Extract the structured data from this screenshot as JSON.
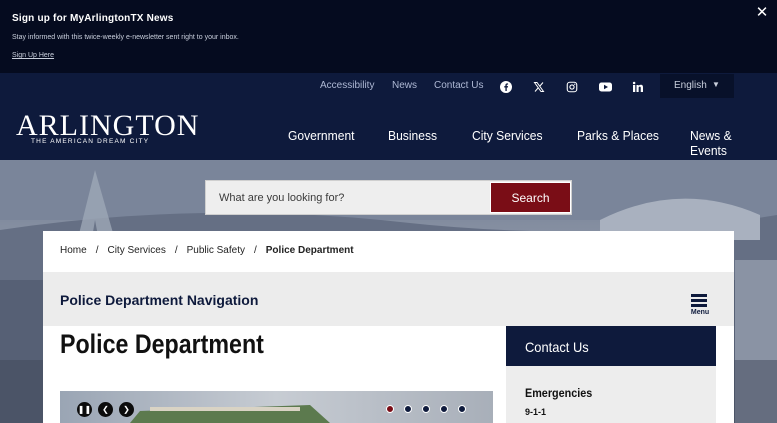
{
  "banner": {
    "title": "Sign up for MyArlingtonTX News",
    "text": "Stay informed with this twice-weekly e-newsletter sent right to your inbox.",
    "link": "Sign Up Here",
    "close": "✕"
  },
  "utility": {
    "links": [
      "Accessibility",
      "News",
      "Contact Us"
    ],
    "social_icons": [
      "facebook-icon",
      "x-twitter-icon",
      "instagram-icon",
      "youtube-icon",
      "linkedin-icon"
    ],
    "language": "English"
  },
  "logo": {
    "name": "ARLINGTON",
    "tagline": "THE AMERICAN DREAM CITY"
  },
  "nav": {
    "items": [
      "Government",
      "Business",
      "City Services",
      "Parks & Places",
      "News & Events"
    ]
  },
  "search": {
    "placeholder": "What are you looking for?",
    "button": "Search"
  },
  "breadcrumb": {
    "items": [
      "Home",
      "City Services",
      "Public Safety"
    ],
    "current": "Police Department",
    "separator": "/"
  },
  "subnav": {
    "title": "Police Department Navigation",
    "menu_label": "Menu"
  },
  "page": {
    "title": "Police Department"
  },
  "carousel": {
    "controls": [
      "pause-icon",
      "prev-icon",
      "next-icon"
    ],
    "dots": 5,
    "active_dot": 1
  },
  "contact": {
    "title": "Contact Us",
    "emergency_title": "Emergencies",
    "emergency_number": "9-1-1"
  },
  "colors": {
    "navy": "#0e1a3c",
    "maroon": "#7a0d16",
    "banner": "#050b1f"
  }
}
